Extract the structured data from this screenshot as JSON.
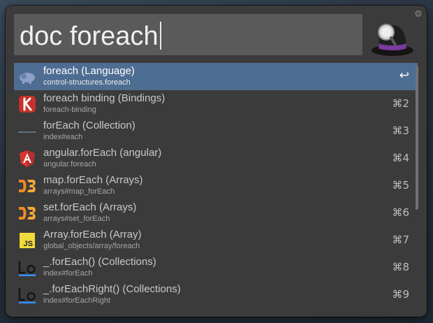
{
  "search": {
    "query": "doc foreach"
  },
  "results": [
    {
      "title": "foreach (Language)",
      "subtitle": "control-structures.foreach",
      "shortcut": "↩",
      "icon": "php-elephant-icon",
      "selected": true
    },
    {
      "title": "foreach binding (Bindings)",
      "subtitle": "foreach-binding",
      "shortcut": "⌘2",
      "icon": "knockout-icon",
      "selected": false
    },
    {
      "title": "forEach (Collection)",
      "subtitle": "index#each",
      "shortcut": "⌘3",
      "icon": "collection-dash-icon",
      "selected": false
    },
    {
      "title": "angular.forEach (angular)",
      "subtitle": "angular.foreach",
      "shortcut": "⌘4",
      "icon": "angular-shield-icon",
      "selected": false
    },
    {
      "title": "map.forEach (Arrays)",
      "subtitle": "arrays#map_forEach",
      "shortcut": "⌘5",
      "icon": "d3-logo-icon",
      "selected": false
    },
    {
      "title": "set.forEach (Arrays)",
      "subtitle": "arrays#set_forEach",
      "shortcut": "⌘6",
      "icon": "d3-logo-icon",
      "selected": false
    },
    {
      "title": "Array.forEach (Array)",
      "subtitle": "global_objects/array/foreach",
      "shortcut": "⌘7",
      "icon": "js-badge-icon",
      "selected": false
    },
    {
      "title": "_.forEach() (Collections)",
      "subtitle": "index#forEach",
      "shortcut": "⌘8",
      "icon": "lodash-icon",
      "selected": false
    },
    {
      "title": "_.forEachRight() (Collections)",
      "subtitle": "index#forEachRight",
      "shortcut": "⌘9",
      "icon": "lodash-icon",
      "selected": false
    }
  ],
  "colors": {
    "window": "#3b3b3b",
    "search_box": "#5a5a5a",
    "selection": "#4e6d92",
    "angular": "#dd3330",
    "d3": "#f08a24",
    "js": "#f2da3a",
    "lodash": "#3492ff"
  }
}
